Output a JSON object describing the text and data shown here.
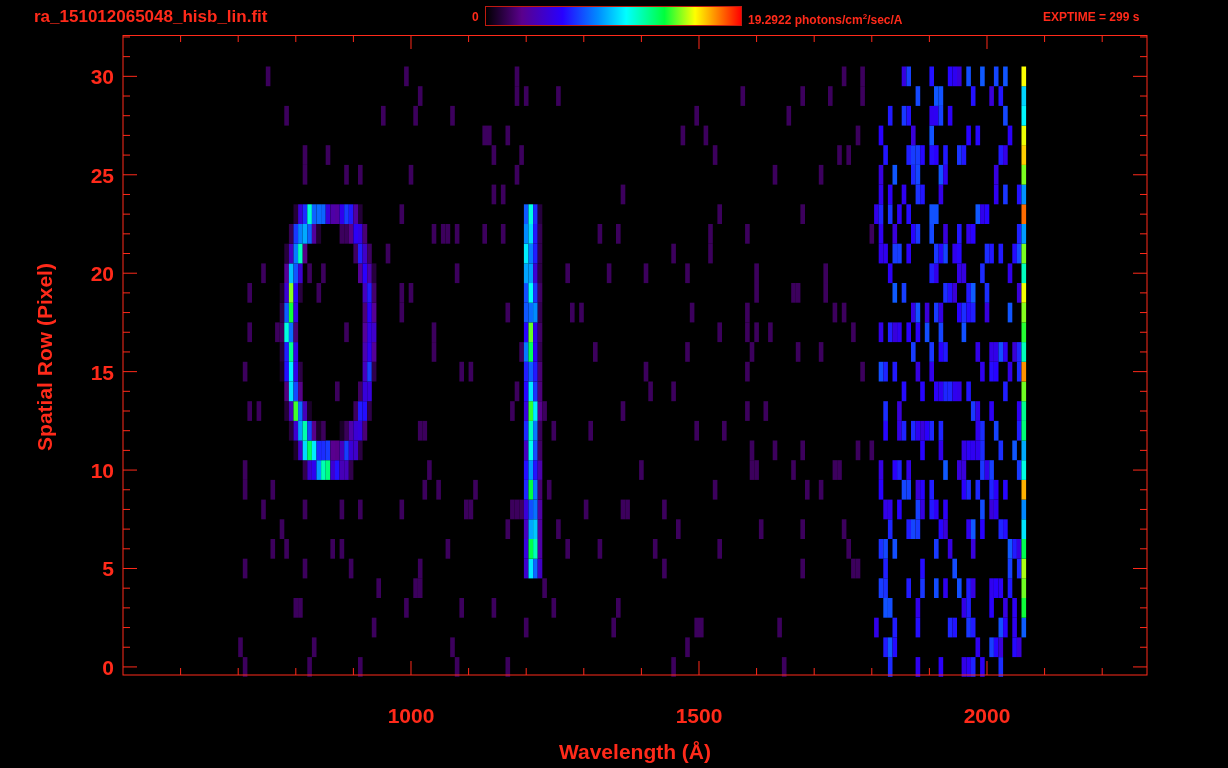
{
  "header": {
    "filename": "ra_151012065048_hisb_lin.fit",
    "colorbar": {
      "min_label": "0",
      "max_label": "19.2922 photons/cm$^{2}$/sec/A"
    },
    "exposure": "EXPTIME = 299 s"
  },
  "plot": {
    "xlabel": "Wavelength (Å)",
    "ylabel": "Spatial Row (Pixel)",
    "xticks": [
      "1000",
      "1500",
      "2000"
    ],
    "yticks": [
      "30",
      "25",
      "20",
      "15",
      "10",
      "5",
      "0"
    ]
  }
}
